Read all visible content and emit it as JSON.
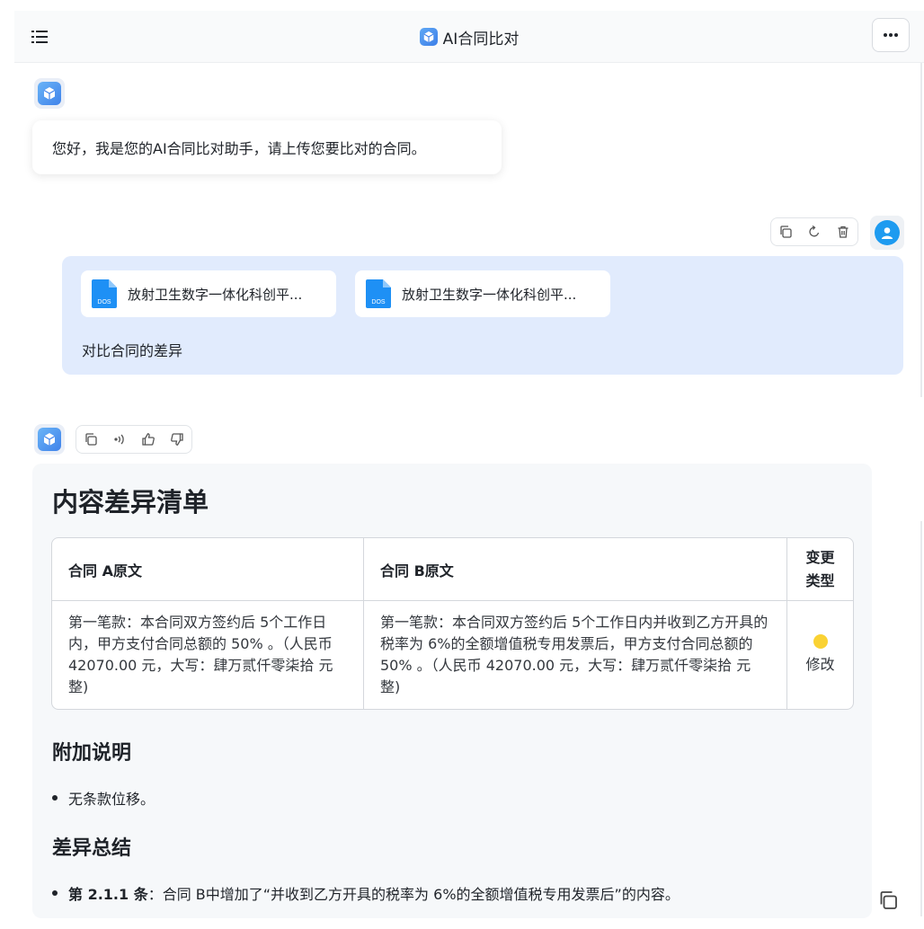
{
  "header": {
    "title": "AI合同比对",
    "menu_icon": "list-icon",
    "more_icon": "more-horizontal-icon"
  },
  "bot_greeting": {
    "text": "您好，我是您的AI合同比对助手，请上传您要比对的合同。"
  },
  "user_message": {
    "actions": [
      "copy-icon",
      "refresh-icon",
      "trash-icon"
    ],
    "files": [
      {
        "name": "放射卫生数字一体化科创平...",
        "type_label": "DOS"
      },
      {
        "name": "放射卫生数字一体化科创平...",
        "type_label": "DOS"
      }
    ],
    "text": "对比合同的差异"
  },
  "bot_answer": {
    "actions": [
      "copy-icon",
      "speaker-icon",
      "thumbs-up-icon",
      "thumbs-down-icon"
    ],
    "heading": "内容差异清单",
    "table": {
      "headers": [
        "合同 A原文",
        "合同 B原文",
        "变更类型"
      ],
      "rows": [
        {
          "a": "第一笔款：本合同双方签约后 5个工作日内，甲方支付合同总额的 50% 。（人民币 42070.00 元，大写：肆万贰仟零柒拾 元整)",
          "b": "第一笔款：本合同双方签约后 5个工作日内并收到乙方开具的税率为 6%的全额增值税专用发票后，甲方支付合同总额的 50% 。（人民币 42070.00 元，大写：肆万贰仟零柒拾 元整)",
          "type": "修改",
          "type_color": "#fad233"
        }
      ]
    },
    "notes_title": "附加说明",
    "notes": [
      "无条款位移。"
    ],
    "summary_title": "差异总结",
    "summary": [
      {
        "bold": "第 2.1.1 条",
        "text": "：合同 B中增加了“并收到乙方开具的税率为 6%的全额增值税专用发票后”的内容。"
      }
    ]
  },
  "colors": {
    "accent": "#3f82ea",
    "user_bubble": "#e1ebfd",
    "answer_bg": "#f6f8fa",
    "badge_modify": "#fad233"
  }
}
